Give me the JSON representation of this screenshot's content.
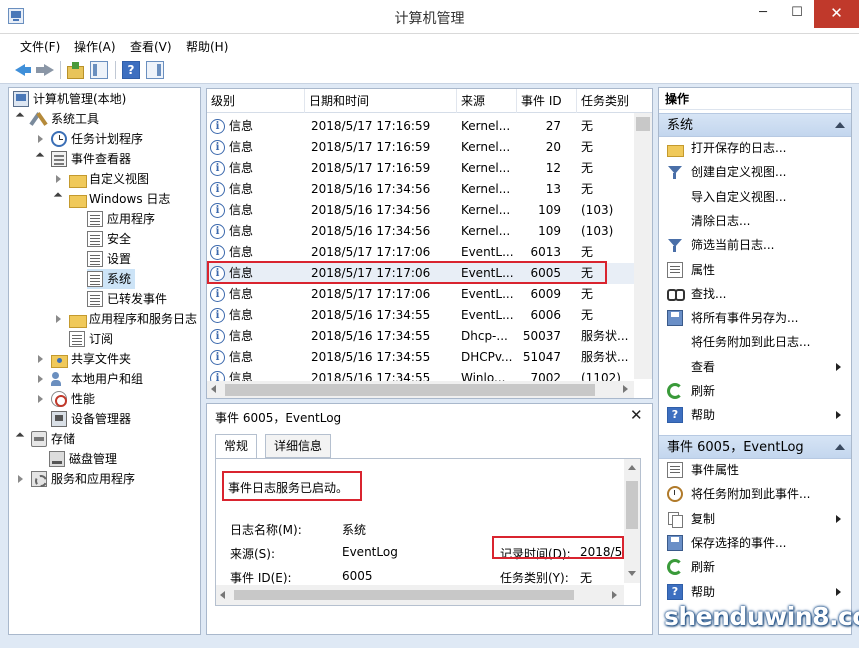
{
  "window": {
    "title": "计算机管理",
    "min": "─",
    "max": "☐",
    "close": "✕"
  },
  "menu": [
    "文件(F)",
    "操作(A)",
    "查看(V)",
    "帮助(H)"
  ],
  "toolbar": {
    "help_glyph": "?"
  },
  "tree": [
    {
      "label": "计算机管理(本地)",
      "icon": "computer-icon"
    },
    {
      "label": "系统工具",
      "icon": "tools-icon"
    },
    {
      "label": "任务计划程序",
      "icon": "clock-icon"
    },
    {
      "label": "事件查看器",
      "icon": "event-viewer-icon"
    },
    {
      "label": "自定义视图",
      "icon": "folder-icon"
    },
    {
      "label": "Windows 日志",
      "icon": "folder-icon"
    },
    {
      "label": "应用程序",
      "icon": "log-icon"
    },
    {
      "label": "安全",
      "icon": "log-icon"
    },
    {
      "label": "设置",
      "icon": "log-icon"
    },
    {
      "label": "系统",
      "icon": "log-icon"
    },
    {
      "label": "已转发事件",
      "icon": "log-icon"
    },
    {
      "label": "应用程序和服务日志",
      "icon": "folder-icon"
    },
    {
      "label": "订阅",
      "icon": "log-icon"
    },
    {
      "label": "共享文件夹",
      "icon": "shared-folder-icon"
    },
    {
      "label": "本地用户和组",
      "icon": "users-icon"
    },
    {
      "label": "性能",
      "icon": "performance-icon"
    },
    {
      "label": "设备管理器",
      "icon": "device-manager-icon"
    },
    {
      "label": "存储",
      "icon": "storage-icon"
    },
    {
      "label": "磁盘管理",
      "icon": "disk-icon"
    },
    {
      "label": "服务和应用程序",
      "icon": "services-icon"
    }
  ],
  "events": {
    "columns": [
      "级别",
      "日期和时间",
      "来源",
      "事件 ID",
      "任务类别"
    ],
    "rows": [
      {
        "level": "信息",
        "datetime": "2018/5/17 17:16:59",
        "source": "Kernel...",
        "id": "27",
        "category": "无"
      },
      {
        "level": "信息",
        "datetime": "2018/5/17 17:16:59",
        "source": "Kernel...",
        "id": "20",
        "category": "无"
      },
      {
        "level": "信息",
        "datetime": "2018/5/17 17:16:59",
        "source": "Kernel...",
        "id": "12",
        "category": "无"
      },
      {
        "level": "信息",
        "datetime": "2018/5/16 17:34:56",
        "source": "Kernel...",
        "id": "13",
        "category": "无"
      },
      {
        "level": "信息",
        "datetime": "2018/5/16 17:34:56",
        "source": "Kernel...",
        "id": "109",
        "category": "(103)"
      },
      {
        "level": "信息",
        "datetime": "2018/5/16 17:34:56",
        "source": "Kernel...",
        "id": "109",
        "category": "(103)"
      },
      {
        "level": "信息",
        "datetime": "2018/5/17 17:17:06",
        "source": "EventL...",
        "id": "6013",
        "category": "无"
      },
      {
        "level": "信息",
        "datetime": "2018/5/17 17:17:06",
        "source": "EventL...",
        "id": "6005",
        "category": "无"
      },
      {
        "level": "信息",
        "datetime": "2018/5/17 17:17:06",
        "source": "EventL...",
        "id": "6009",
        "category": "无"
      },
      {
        "level": "信息",
        "datetime": "2018/5/16 17:34:55",
        "source": "EventL...",
        "id": "6006",
        "category": "无"
      },
      {
        "level": "信息",
        "datetime": "2018/5/16 17:34:55",
        "source": "Dhcp-...",
        "id": "50037",
        "category": "服务状..."
      },
      {
        "level": "信息",
        "datetime": "2018/5/16 17:34:55",
        "source": "DHCPv...",
        "id": "51047",
        "category": "服务状..."
      },
      {
        "level": "信息",
        "datetime": "2018/5/16 17:34:55",
        "source": "Winlo...",
        "id": "7002",
        "category": "(1102)"
      }
    ]
  },
  "detail": {
    "title": "事件 6005，EventLog",
    "close": "✕",
    "tabs": [
      "常规",
      "详细信息"
    ],
    "message": "事件日志服务已启动。",
    "log_name_label": "日志名称(M):",
    "log_name": "系统",
    "source_label": "来源(S):",
    "source": "EventLog",
    "record_time_label": "记录时间(D):",
    "record_time": "2018/5/",
    "event_id_label": "事件 ID(E):",
    "event_id": "6005",
    "category_label": "任务类别(Y):",
    "category": "无"
  },
  "actions": {
    "header": "操作",
    "section1": "系统",
    "items1": [
      {
        "label": "打开保存的日志...",
        "icon": "open-folder-icon",
        "submenu": false
      },
      {
        "label": "创建自定义视图...",
        "icon": "filter-icon",
        "submenu": false
      },
      {
        "label": "导入自定义视图...",
        "icon": "",
        "submenu": false
      },
      {
        "label": "清除日志...",
        "icon": "",
        "submenu": false
      },
      {
        "label": "筛选当前日志...",
        "icon": "filter-icon",
        "submenu": false
      },
      {
        "label": "属性",
        "icon": "properties-icon",
        "submenu": false
      },
      {
        "label": "查找...",
        "icon": "find-icon",
        "submenu": false
      },
      {
        "label": "将所有事件另存为...",
        "icon": "save-icon",
        "submenu": false
      },
      {
        "label": "将任务附加到此日志...",
        "icon": "",
        "submenu": false
      },
      {
        "label": "查看",
        "icon": "",
        "submenu": true
      },
      {
        "label": "刷新",
        "icon": "refresh-icon",
        "submenu": false
      },
      {
        "label": "帮助",
        "icon": "help-icon",
        "submenu": true
      }
    ],
    "section2": "事件 6005，EventLog",
    "items2": [
      {
        "label": "事件属性",
        "icon": "properties-icon",
        "submenu": false
      },
      {
        "label": "将任务附加到此事件...",
        "icon": "task-icon",
        "submenu": false
      },
      {
        "label": "复制",
        "icon": "copy-icon",
        "submenu": true
      },
      {
        "label": "保存选择的事件...",
        "icon": "save-icon",
        "submenu": false
      },
      {
        "label": "刷新",
        "icon": "refresh-icon",
        "submenu": false
      },
      {
        "label": "帮助",
        "icon": "help-icon",
        "submenu": true
      }
    ]
  },
  "watermark": "shenduwin8.com"
}
